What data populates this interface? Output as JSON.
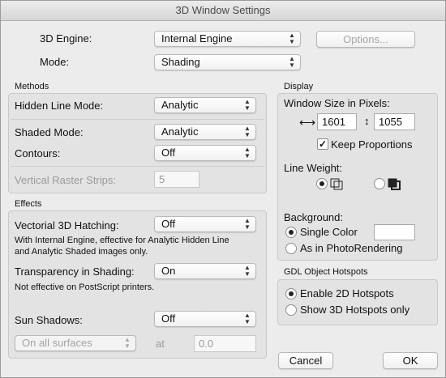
{
  "window": {
    "title": "3D Window Settings"
  },
  "top": {
    "engine_label": "3D Engine:",
    "engine_value": "Internal Engine",
    "options_label": "Options...",
    "mode_label": "Mode:",
    "mode_value": "Shading"
  },
  "methods": {
    "title": "Methods",
    "hidden_line_label": "Hidden Line Mode:",
    "hidden_line_value": "Analytic",
    "shaded_label": "Shaded Mode:",
    "shaded_value": "Analytic",
    "contours_label": "Contours:",
    "contours_value": "Off",
    "raster_label": "Vertical Raster Strips:",
    "raster_value": "5"
  },
  "effects": {
    "title": "Effects",
    "hatching_label": "Vectorial 3D Hatching:",
    "hatching_value": "Off",
    "hatching_note_1": "With Internal Engine, effective for Analytic Hidden Line",
    "hatching_note_2": "and Analytic Shaded images only.",
    "transparency_label": "Transparency in Shading:",
    "transparency_value": "On",
    "transparency_note": "Not effective on PostScript printers.",
    "sun_label": "Sun Shadows:",
    "sun_value": "Off",
    "surfaces_value": "On all surfaces",
    "at_label": "at",
    "at_value": "0.0"
  },
  "display": {
    "title": "Display",
    "window_size_label": "Window Size in Pixels:",
    "width_value": "1601",
    "height_value": "1055",
    "keep_proportions": "Keep Proportions",
    "line_weight_label": "Line Weight:",
    "background_label": "Background:",
    "single_color_label": "Single Color",
    "photorendering_label": "As in PhotoRendering"
  },
  "hotspots": {
    "title": "GDL Object Hotspots",
    "enable_2d": "Enable 2D Hotspots",
    "show_3d": "Show 3D Hotspots only"
  },
  "footer": {
    "cancel": "Cancel",
    "ok": "OK"
  }
}
